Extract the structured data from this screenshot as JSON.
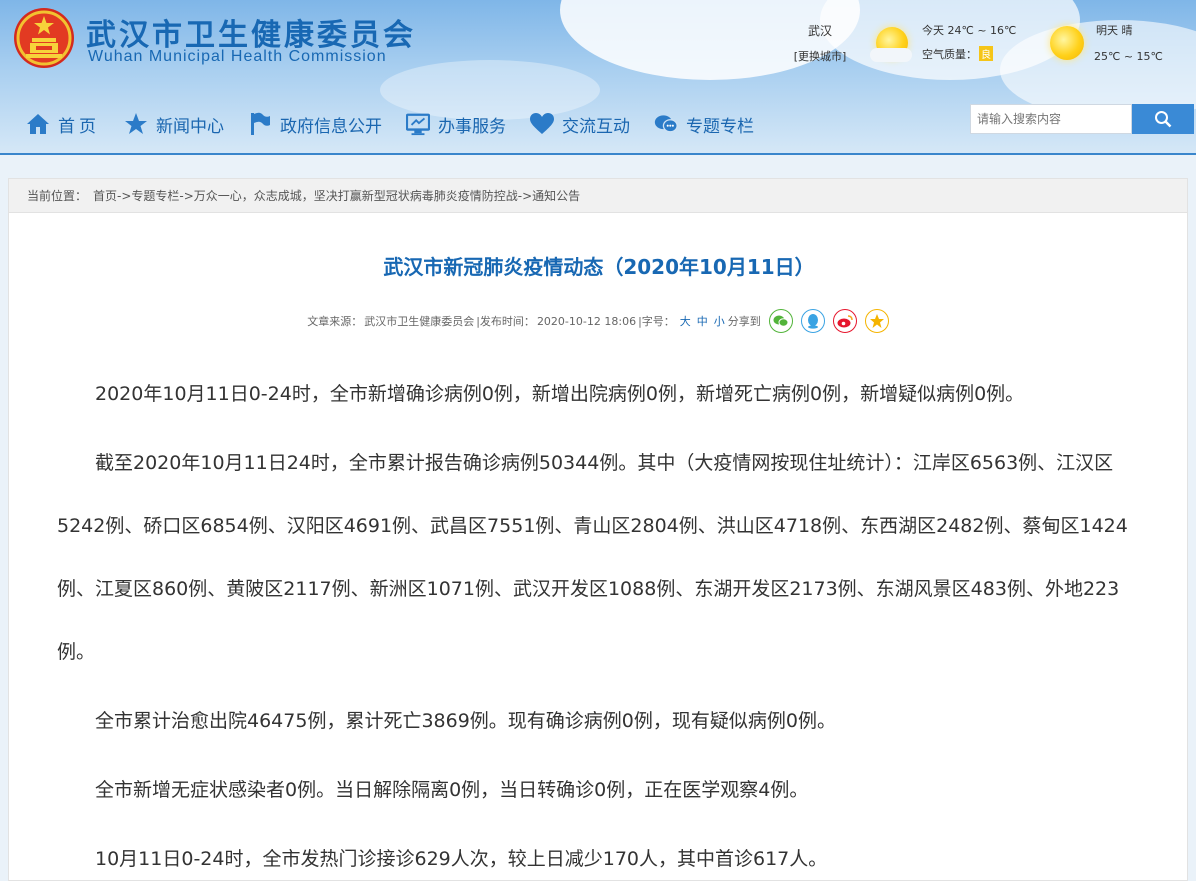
{
  "site": {
    "title_cn": "武汉市卫生健康委员会",
    "title_en": "Wuhan Municipal Health Commission"
  },
  "weather": {
    "city": "武汉",
    "change_city": "[更换城市]",
    "today": "今天 24℃ ~ 16℃",
    "air_label": "空气质量：",
    "air_value": "良",
    "tomorrow": "明天 晴",
    "tomorrow_temp": "25℃ ~ 15℃"
  },
  "nav": {
    "items": [
      {
        "label": "首页",
        "icon": "home-icon"
      },
      {
        "label": "新闻中心",
        "icon": "star-icon"
      },
      {
        "label": "政府信息公开",
        "icon": "flag-icon"
      },
      {
        "label": "办事服务",
        "icon": "monitor-icon"
      },
      {
        "label": "交流互动",
        "icon": "heart-icon"
      },
      {
        "label": "专题专栏",
        "icon": "chat-icon"
      }
    ]
  },
  "search": {
    "placeholder": "请输入搜索内容"
  },
  "breadcrumb": {
    "caption": "当前位置：",
    "path": "首页->专题专栏->万众一心，众志成城，坚决打赢新型冠状病毒肺炎疫情防控战->通知公告"
  },
  "article": {
    "title": "武汉市新冠肺炎疫情动态（2020年10月11日）",
    "source_label": "文章来源：",
    "source": "武汉市卫生健康委员会",
    "publish_label": "|发布时间：",
    "publish_time": "2020-10-12 18:06",
    "font_label": "|字号：",
    "font_sizes": [
      "大",
      "中",
      "小"
    ],
    "share_label": "分享到",
    "share_targets": [
      {
        "icon": "wechat-icon",
        "color": "#52b43a"
      },
      {
        "icon": "qq-icon",
        "color": "#3aa3e3"
      },
      {
        "icon": "weibo-icon",
        "color": "#e6162d"
      },
      {
        "icon": "qzone-icon",
        "color": "#f5b400"
      }
    ],
    "paragraphs": [
      "2020年10月11日0-24时，全市新增确诊病例0例，新增出院病例0例，新增死亡病例0例，新增疑似病例0例。",
      "截至2020年10月11日24时，全市累计报告确诊病例50344例。其中（大疫情网按现住址统计）：江岸区6563例、江汉区5242例、硚口区6854例、汉阳区4691例、武昌区7551例、青山区2804例、洪山区4718例、东西湖区2482例、蔡甸区1424例、江夏区860例、黄陂区2117例、新洲区1071例、武汉开发区1088例、东湖开发区2173例、东湖风景区483例、外地223例。",
      "全市累计治愈出院46475例，累计死亡3869例。现有确诊病例0例，现有疑似病例0例。",
      "全市新增无症状感染者0例。当日解除隔离0例，当日转确诊0例，正在医学观察4例。",
      "10月11日0-24时，全市发热门诊接诊629人次，较上日减少170人，其中首诊617人。"
    ]
  }
}
